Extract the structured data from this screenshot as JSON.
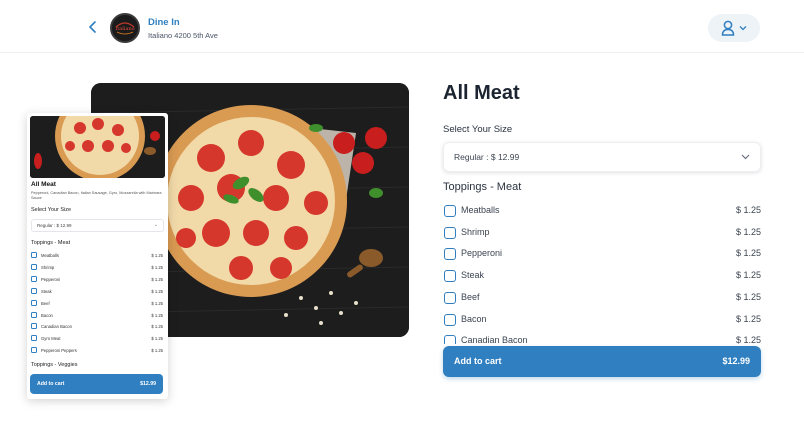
{
  "header": {
    "back_icon": "chevron-left-icon",
    "restaurant_name": "Dine In",
    "restaurant_address": "Italiano 4200 5th Ave",
    "logo_text": "Italiano",
    "user_icon": "user-icon",
    "user_chevron_icon": "chevron-down-icon"
  },
  "product": {
    "name": "All Meat",
    "size_label": "Select Your Size",
    "size_value": "Regular : $ 12.99",
    "toppings_label": "Toppings - Meat",
    "toppings": [
      {
        "name": "Meatballs",
        "price": "$ 1.25"
      },
      {
        "name": "Shrimp",
        "price": "$ 1.25"
      },
      {
        "name": "Pepperoni",
        "price": "$ 1.25"
      },
      {
        "name": "Steak",
        "price": "$ 1.25"
      },
      {
        "name": "Beef",
        "price": "$ 1.25"
      },
      {
        "name": "Bacon",
        "price": "$ 1.25"
      },
      {
        "name": "Canadian Bacon",
        "price": "$ 1.25"
      }
    ],
    "cart_label": "Add to cart",
    "cart_total": "$12.99"
  },
  "mobile_preview": {
    "name": "All Meat",
    "description": "Pepperoni, Canadian Bacon, Italian Sausage, Gyro, Mozzarella with Marinara Sauce",
    "size_label": "Select Your Size",
    "size_value": "Regular : $ 12.99",
    "toppings_label": "Toppings - Meat",
    "toppings": [
      {
        "name": "Meatballs",
        "price": "$ 1.25"
      },
      {
        "name": "Shrimp",
        "price": "$ 1.25"
      },
      {
        "name": "Pepperoni",
        "price": "$ 1.25"
      },
      {
        "name": "Steak",
        "price": "$ 1.25"
      },
      {
        "name": "Beef",
        "price": "$ 1.25"
      },
      {
        "name": "Bacon",
        "price": "$ 1.25"
      },
      {
        "name": "Canadian Bacon",
        "price": "$ 1.25"
      },
      {
        "name": "Gyro Meat",
        "price": "$ 1.25"
      },
      {
        "name": "Pepperoni Peppers",
        "price": "$ 1.25"
      }
    ],
    "veggies_label": "Toppings - Veggies",
    "cart_label": "Add to cart",
    "cart_total": "$12.99"
  },
  "colors": {
    "accent": "#2f7fc1",
    "text": "#1b2430"
  }
}
